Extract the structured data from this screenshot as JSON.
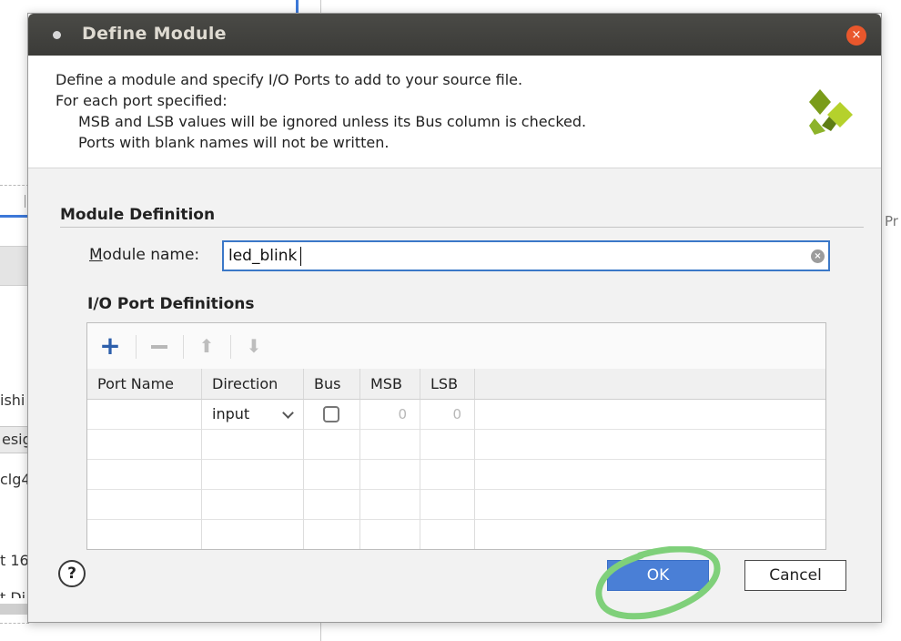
{
  "background": {
    "fragments": [
      "ishi",
      "esig",
      "clg4",
      "t 16",
      "t Di"
    ],
    "right_edge_text": "Pr"
  },
  "dialog": {
    "title": "Define Module",
    "close_glyph": "×",
    "description": [
      "Define a module and specify I/O Ports to add to your source file.",
      "For each port specified:",
      "MSB and LSB values will be ignored unless its Bus column is checked.",
      "Ports with blank names will not be written."
    ],
    "logo_icon": "xilinx-logo-icon",
    "module_definition": {
      "section_title": "Module Definition",
      "module_name_label_mnemonic": "M",
      "module_name_label_rest": "odule name:",
      "module_name_value": "led_blink",
      "clear_glyph": "×"
    },
    "io_ports": {
      "section_title": "I/O Port Definitions",
      "toolbar": {
        "add_icon": "plus-icon",
        "add_glyph": "+",
        "remove_icon": "minus-icon",
        "move_up_icon": "arrow-up-icon",
        "move_up_glyph": "⬆",
        "move_down_icon": "arrow-down-icon",
        "move_down_glyph": "⬇"
      },
      "columns": [
        "Port Name",
        "Direction",
        "Bus",
        "MSB",
        "LSB"
      ],
      "rows": [
        {
          "port_name": "",
          "direction": "input",
          "bus": false,
          "msb": "0",
          "lsb": "0"
        }
      ],
      "empty_rows": 4
    },
    "buttons": {
      "help": "?",
      "ok": "OK",
      "cancel": "Cancel"
    },
    "annotation_color": "#7fd07a"
  }
}
